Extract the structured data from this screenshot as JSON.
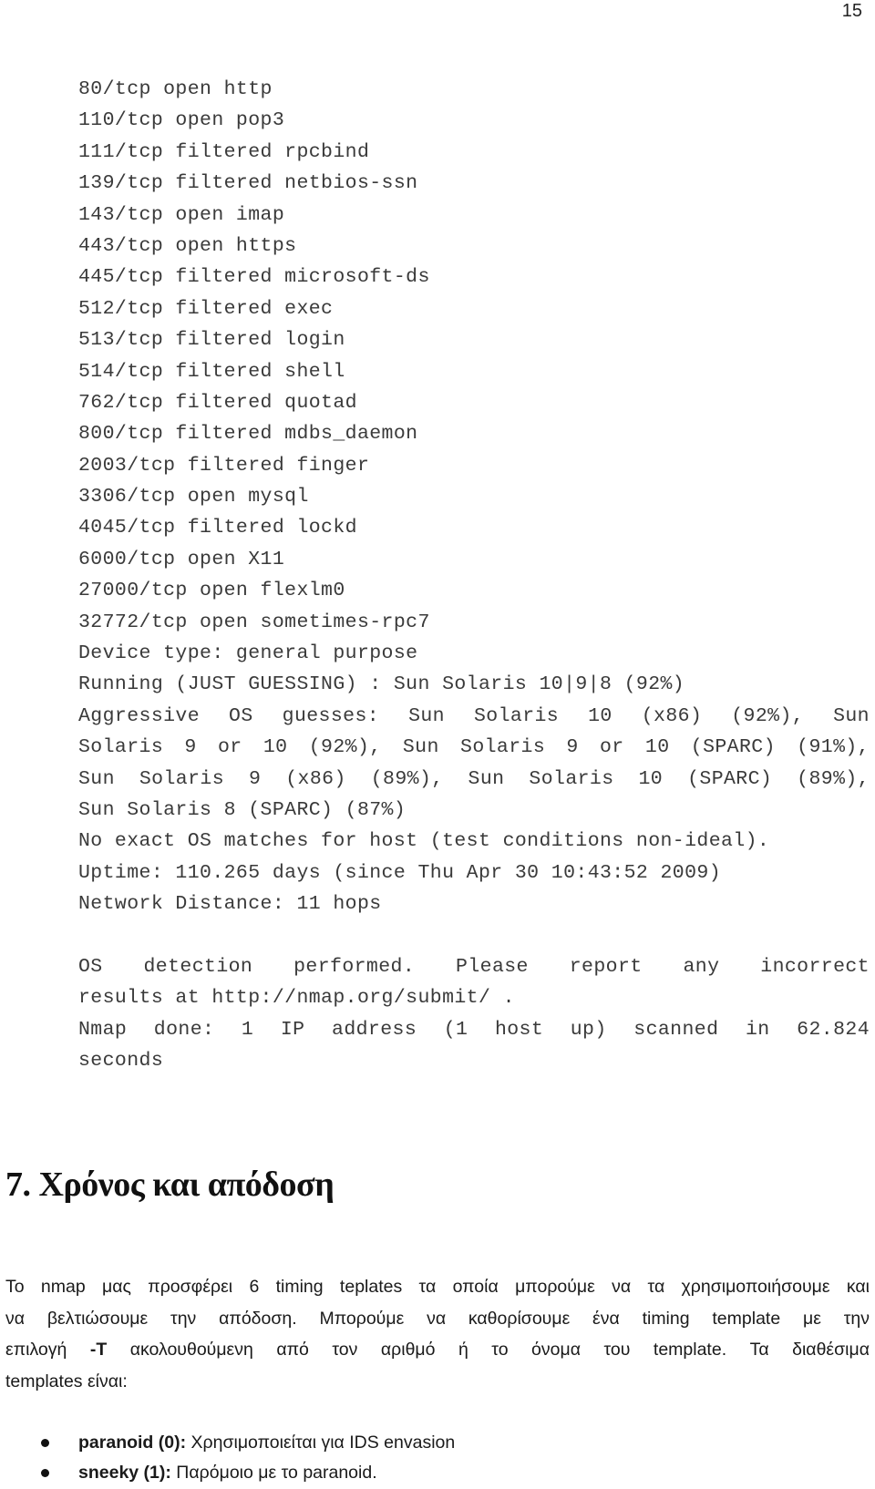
{
  "page_number": "15",
  "nmap_output": {
    "ports": [
      "80/tcp open http",
      "110/tcp open pop3",
      "111/tcp filtered rpcbind",
      "139/tcp filtered netbios-ssn",
      "143/tcp open imap",
      "443/tcp open https",
      "445/tcp filtered microsoft-ds",
      "512/tcp filtered exec",
      "513/tcp filtered login",
      "514/tcp filtered shell",
      "762/tcp filtered quotad",
      "800/tcp filtered mdbs_daemon",
      "2003/tcp filtered finger",
      "3306/tcp open mysql",
      "4045/tcp filtered lockd",
      "6000/tcp open X11",
      "27000/tcp open flexlm0",
      "32772/tcp open sometimes-rpc7"
    ],
    "device_type": "Device type: general purpose",
    "running": "Running (JUST GUESSING) : Sun Solaris 10|9|8 (92%)",
    "aggressive_guesses": [
      "Aggressive OS guesses: Sun Solaris 10 (x86) (92%), Sun",
      "Solaris 9 or 10 (92%), Sun Solaris 9 or 10 (SPARC) (91%),",
      "Sun Solaris 9 (x86) (89%), Sun Solaris 10 (SPARC) (89%),",
      "Sun Solaris 8 (SPARC) (87%)"
    ],
    "no_exact_match": "No exact OS matches for host (test conditions non-ideal).",
    "uptime": "Uptime: 110.265 days (since Thu Apr 30 10:43:52 2009)",
    "network_distance": "Network Distance: 11 hops",
    "footer_lines": [
      "OS detection performed. Please report any incorrect",
      "results at http://nmap.org/submit/ .",
      "Nmap done: 1 IP address (1 host up) scanned in 62.824",
      "seconds"
    ]
  },
  "section": {
    "heading": "7. Χρόνος και απόδοση",
    "paragraph": {
      "line1": "Το nmap μας προσφέρει 6 timing teplates τα οποία μπορούμε να τα χρησιμοποιήσουμε και",
      "line2": "να βελτιώσουμε την απόδοση. Μπορούμε να καθορίσουμε ένα timing template με την",
      "line3_pre": "επιλογή ",
      "line3_bold": "-T",
      "line3_post": " ακολουθούμενη από τον αριθμό ή το όνομα του template. Τα διαθέσιμα",
      "line4": "templates είναι:"
    },
    "templates": [
      {
        "term": "paranoid (0):",
        "description": " Χρησιμοποιείται για IDS envasion"
      },
      {
        "term": "sneeky (1):",
        "description": " Παρόμοιο με το paranoid."
      }
    ]
  }
}
